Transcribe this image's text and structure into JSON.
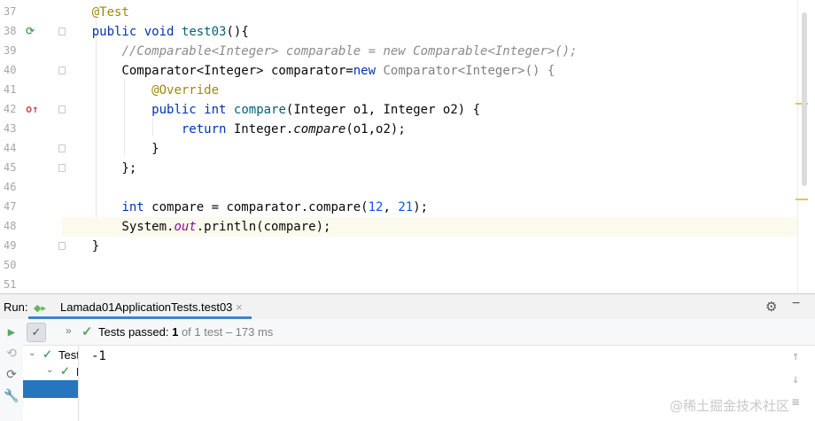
{
  "editor": {
    "lines": [
      {
        "no": "37",
        "tokens": [
          {
            "t": "    "
          },
          {
            "t": "@Test",
            "c": "ann"
          }
        ]
      },
      {
        "no": "38",
        "tokens": [
          {
            "t": "    "
          },
          {
            "t": "public",
            "c": "kw"
          },
          {
            "t": " "
          },
          {
            "t": "void",
            "c": "kw"
          },
          {
            "t": " "
          },
          {
            "t": "test03",
            "c": "fn"
          },
          {
            "t": "(){"
          }
        ]
      },
      {
        "no": "39",
        "tokens": [
          {
            "t": "        "
          },
          {
            "t": "//Comparable<Integer> comparable = new Comparable<Integer>();",
            "c": "cmt"
          }
        ]
      },
      {
        "no": "40",
        "tokens": [
          {
            "t": "        Comparator<Integer> comparator="
          },
          {
            "t": "new",
            "c": "kw"
          },
          {
            "t": " Comparator<Integer>() {",
            "c": "gen"
          }
        ]
      },
      {
        "no": "41",
        "tokens": [
          {
            "t": "            "
          },
          {
            "t": "@Override",
            "c": "ann"
          }
        ]
      },
      {
        "no": "42",
        "tokens": [
          {
            "t": "            "
          },
          {
            "t": "public",
            "c": "kw"
          },
          {
            "t": " "
          },
          {
            "t": "int",
            "c": "kw"
          },
          {
            "t": " "
          },
          {
            "t": "compare",
            "c": "fn"
          },
          {
            "t": "(Integer o1, Integer o2) {"
          }
        ]
      },
      {
        "no": "43",
        "tokens": [
          {
            "t": "                "
          },
          {
            "t": "return",
            "c": "kw"
          },
          {
            "t": " Integer."
          },
          {
            "t": "compare",
            "c": "ital"
          },
          {
            "t": "(o1,o2);"
          }
        ]
      },
      {
        "no": "44",
        "tokens": [
          {
            "t": "            }"
          }
        ]
      },
      {
        "no": "45",
        "tokens": [
          {
            "t": "        };"
          }
        ]
      },
      {
        "no": "46",
        "tokens": []
      },
      {
        "no": "47",
        "tokens": [
          {
            "t": "        "
          },
          {
            "t": "int",
            "c": "kw"
          },
          {
            "t": " compare = comparator.compare("
          },
          {
            "t": "12",
            "c": "num"
          },
          {
            "t": ", "
          },
          {
            "t": "21",
            "c": "num"
          },
          {
            "t": ");"
          }
        ]
      },
      {
        "no": "48",
        "tokens": [
          {
            "t": "        System."
          },
          {
            "t": "out",
            "c": "fld"
          },
          {
            "t": ".println(compare);"
          }
        ],
        "current": true
      },
      {
        "no": "49",
        "tokens": [
          {
            "t": "    }"
          }
        ]
      },
      {
        "no": "50",
        "tokens": []
      },
      {
        "no": "51",
        "tokens": []
      }
    ],
    "gutter_icons": [
      {
        "line": "38",
        "icon": "run-test-icon",
        "glyph": "⟳",
        "color": "#59a869"
      },
      {
        "line": "42",
        "icon": "override-method-icon",
        "glyph": "o↑",
        "color": "#c75450"
      }
    ],
    "fold_lines": [
      "38",
      "40",
      "42",
      "44",
      "45",
      "49"
    ]
  },
  "run": {
    "label": "Run:",
    "tab_label": "Lamada01ApplicationTests.test03",
    "close_icon": "×",
    "settings_icon": "⚙",
    "minimize_icon": "−",
    "status_prefix": "Tests passed: ",
    "passed": "1",
    "status_suffix": " of 1 test – 173 ms",
    "tree": [
      {
        "label": "Test",
        "level": 0,
        "expanded": true
      },
      {
        "label": "L",
        "level": 1,
        "expanded": true
      },
      {
        "label": "",
        "level": 2,
        "selected": true
      }
    ],
    "console_output": "-1"
  },
  "watermark": "@稀土掘金技术社区",
  "colors": {
    "accent": "#4083c9",
    "pass": "#59a869",
    "selection": "#2675bf"
  }
}
